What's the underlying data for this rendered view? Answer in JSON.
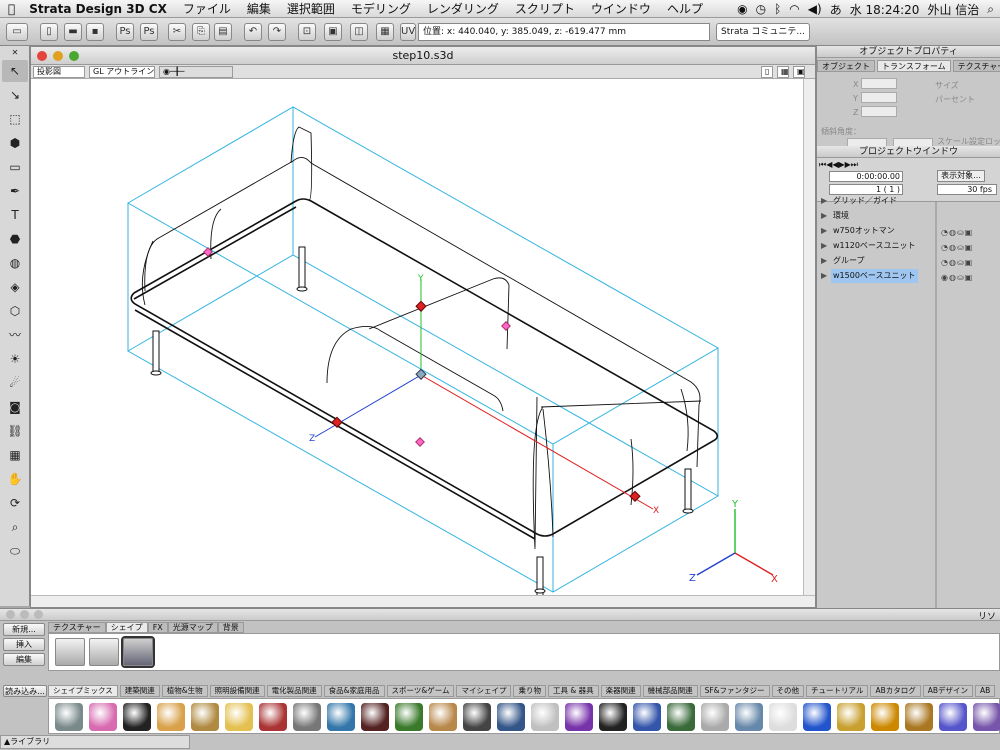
{
  "menubar": {
    "app_name": "Strata Design 3D CX",
    "menus": [
      "ファイル",
      "編集",
      "選択範囲",
      "モデリング",
      "レンダリング",
      "スクリプト",
      "ウインドウ",
      "ヘルプ"
    ],
    "clock": "水 18:24:20",
    "user": "外山 信治",
    "input_mode": "あ"
  },
  "toolbar": {
    "coords": "位置: x: 440.040, y: 385.049, z: -619.477 mm",
    "community": "Strata コミュニテ..."
  },
  "document": {
    "title": "step10.s3d",
    "projection": "投影図",
    "render_mode": "GL アウトライン"
  },
  "axes": {
    "y": "Y",
    "x": "X",
    "z": "Z"
  },
  "object_properties": {
    "title": "オブジェクトプロパティ",
    "tabs": [
      "オブジェクト",
      "トランスフォーム",
      "テクスチャー"
    ],
    "active_tab": 1,
    "size_label": "サイズ",
    "percent_label": "パーセント",
    "rotate_label": "傾斜角度：",
    "scale_lock": "スケール設定ロック",
    "x": "X",
    "y": "Y",
    "z": "Z"
  },
  "project_window": {
    "title": "プロジェクトウインドウ",
    "time": "0:00:00.00",
    "frame": "1 ( 1 )",
    "show_objects": "表示対象...",
    "fps": "30 fps",
    "items": [
      {
        "label": "グリッド／ガイド",
        "selected": false
      },
      {
        "label": "環境",
        "selected": false
      },
      {
        "label": "w750オットマン",
        "selected": false
      },
      {
        "label": "w1120ベースユニット",
        "selected": false
      },
      {
        "label": "グループ",
        "selected": false
      },
      {
        "label": "w1500ベースユニット",
        "selected": true
      }
    ]
  },
  "library": {
    "title_right": "リソ",
    "buttons": {
      "new": "新規...",
      "insert": "挿入",
      "edit": "編集"
    },
    "tabs": [
      "テクスチャー",
      "シェイプ",
      "FX",
      "光源マップ",
      "背景"
    ],
    "active_tab": 1,
    "load_button": "読み込み...",
    "categories": [
      "シェイプミックス",
      "建築関連",
      "植物&生物",
      "照明設備関連",
      "電化製品関連",
      "食品&家庭用品",
      "スポーツ&ゲーム",
      "マイシェイプ",
      "乗り物",
      "工具 & 器具",
      "楽器関連",
      "機械部品関連",
      "SF&ファンタジー",
      "その他",
      "チュートリアル",
      "ABカタログ",
      "ABデザイン",
      "AB"
    ],
    "active_category": 0,
    "footer": "▲ライブラリ",
    "icon_colors": [
      "#7a8a8a",
      "#d86ab0",
      "#222222",
      "#d9a14a",
      "#b08a40",
      "#e4c050",
      "#aa3333",
      "#777777",
      "#3377aa",
      "#552222",
      "#3a7a2a",
      "#b8884a",
      "#444444",
      "#335588",
      "#c0c0c0",
      "#7733aa",
      "#222222",
      "#3355aa",
      "#3a6a3a",
      "#aaaaaa",
      "#6688aa",
      "#dddddd",
      "#2255cc",
      "#c8a030",
      "#cc8800",
      "#aa7722",
      "#5555cc",
      "#7755aa"
    ]
  }
}
